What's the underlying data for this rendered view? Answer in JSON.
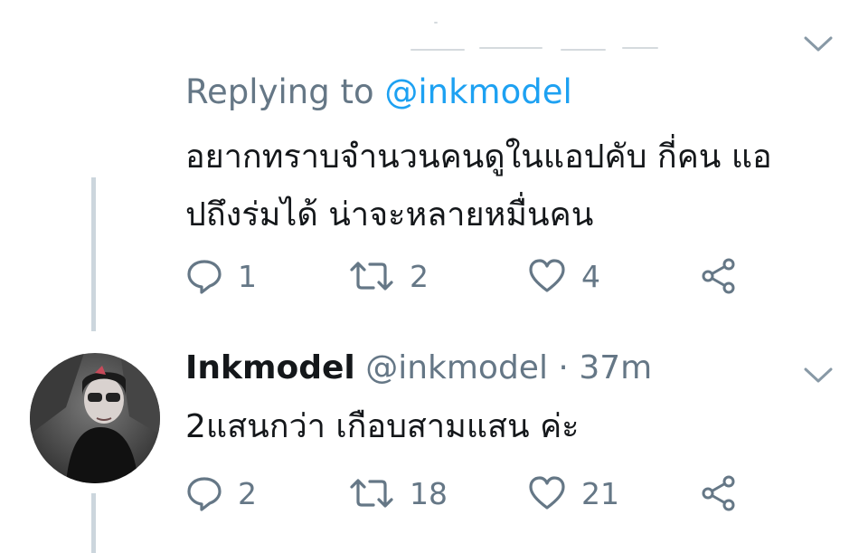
{
  "parent_tweet": {
    "replying_prefix": "Replying to",
    "replying_handle": "@inkmodel",
    "text_line1": "อยากทราบจำนวนคนดูในแอปคับ กี่คน แอ",
    "text_line2": "ปถึงร่มได้ น่าจะหลายหมื่นคน",
    "reply_count": "1",
    "retweet_count": "2",
    "like_count": "4"
  },
  "reply_tweet": {
    "display_name": "Inkmodel",
    "handle": "@inkmodel",
    "separator": "·",
    "timestamp": "37m",
    "text": "2แสนกว่า เกือบสามแสน ค่ะ",
    "reply_count": "2",
    "retweet_count": "18",
    "like_count": "21"
  },
  "icons": {
    "reply": "comment-bubble-icon",
    "retweet": "retweet-icon",
    "like": "heart-icon",
    "share": "share-icon",
    "caret": "chevron-down-icon",
    "avatar": "user-avatar"
  },
  "colors": {
    "text": "#14171a",
    "secondary": "#657786",
    "link": "#1da1f2",
    "thread_line": "#ccd6dd"
  }
}
